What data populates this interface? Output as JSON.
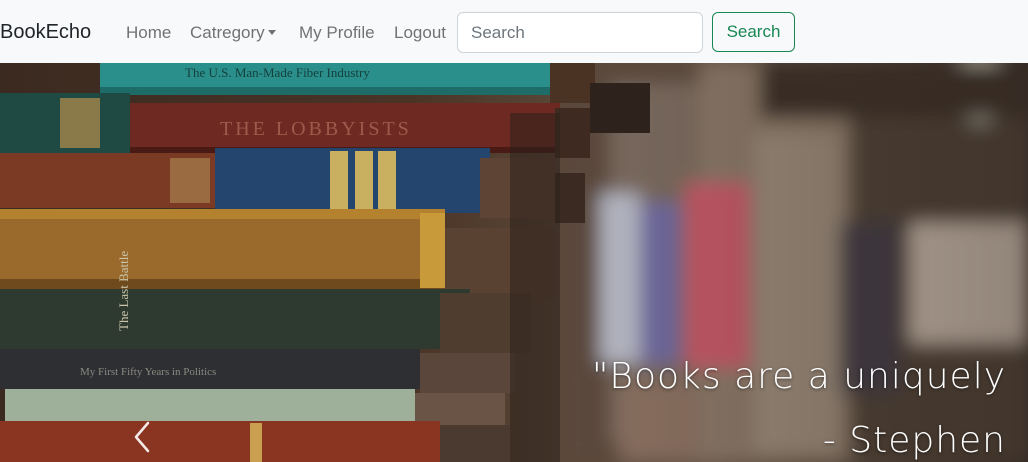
{
  "navbar": {
    "brand": "BookEcho",
    "links": {
      "home": "Home",
      "category": "Catregory",
      "profile": "My Profile",
      "logout": "Logout"
    },
    "search": {
      "placeholder": "Search",
      "button_label": "Search"
    }
  },
  "carousel": {
    "quote_line1": "\"Books are a uniquely",
    "quote_line2": "- Stephen",
    "prev_icon": "chevron-left-icon",
    "book_spine_titles": [
      "The U.S. Man-Made Fiber Industry",
      "THE LOBBYISTS",
      "The Last Battle",
      "My First Fifty Years in Politics"
    ]
  },
  "colors": {
    "navbar_bg": "#f8f9fa",
    "accent_green": "#198754",
    "link_gray": "#6c757d"
  }
}
